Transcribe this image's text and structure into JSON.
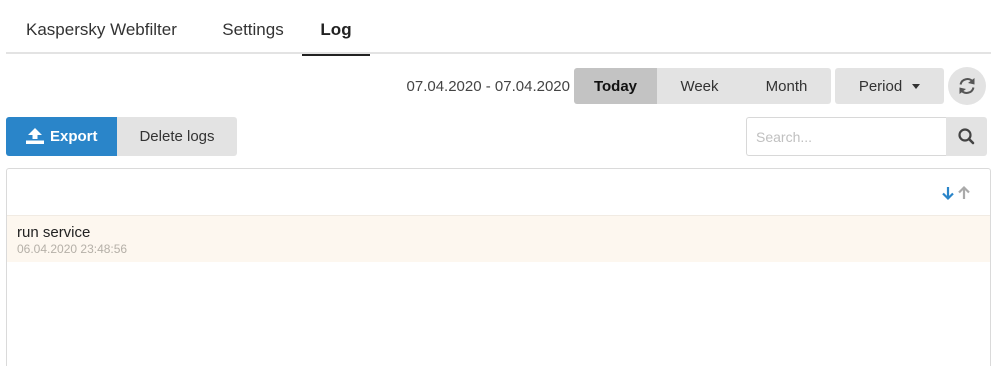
{
  "tabs": [
    {
      "label": "Kaspersky Webfilter",
      "active": false
    },
    {
      "label": "Settings",
      "active": false
    },
    {
      "label": "Log",
      "active": true
    }
  ],
  "toolbar": {
    "date_range": "07.04.2020 - 07.04.2020",
    "periods": [
      "Today",
      "Week",
      "Month"
    ],
    "active_period": "Today",
    "custom_period_label": "Period",
    "refresh_icon": "refresh-icon"
  },
  "actions": {
    "export_label": "Export",
    "export_icon": "upload-icon",
    "delete_label": "Delete logs"
  },
  "search": {
    "placeholder": "Search...",
    "value": "",
    "icon": "search-icon"
  },
  "log": {
    "sort_icons": [
      "arrow-down-icon",
      "arrow-up-icon"
    ],
    "entries": [
      {
        "message": "run service",
        "timestamp": "06.04.2020 23:48:56"
      }
    ]
  },
  "colors": {
    "accent": "#2a85c9",
    "segment_bg": "#e3e3e3",
    "segment_active_bg": "#c3c3c3",
    "row_highlight": "#fdf7ef"
  }
}
